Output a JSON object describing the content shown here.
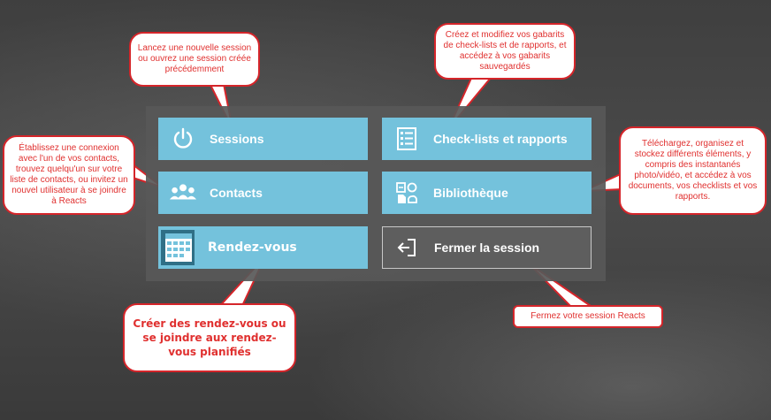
{
  "tiles": {
    "sessions": "Sessions",
    "checklists": "Check-lists et rapports",
    "contacts": "Contacts",
    "bibliotheque": "Bibliothèque",
    "rendezvous": "Rendez-vous",
    "logout": "Fermer la session"
  },
  "callouts": {
    "sessions": "Lancez une nouvelle session ou ouvrez une session créée précédemment",
    "checklists": "Créez et modifiez vos gabarits de check-lists et de rapports, et accédez à vos gabarits sauvegardés",
    "contacts": "Établissez une connexion avec l'un de vos contacts, trouvez quelqu'un sur votre liste de contacts, ou invitez un nouvel utilisateur à se joindre à Reacts",
    "bibliotheque": "Téléchargez, organisez et stockez différents éléments, y compris des instantanés photo/vidéo, et accédez à vos documents, vos checklists et vos rapports.",
    "rendezvous": "Créer des rendez-vous ou se joindre aux rendez-vous planifiés",
    "logout": "Fermez votre session Reacts"
  },
  "colors": {
    "tile": "#74c2dc",
    "logout_tile": "#5e5e5e",
    "panel": "#585858",
    "callout_border": "#d5252a",
    "callout_text": "#e0302f"
  },
  "icons": {
    "sessions": "power-icon",
    "checklists": "checklist-icon",
    "contacts": "people-icon",
    "bibliotheque": "library-icon",
    "rendezvous": "calendar-icon",
    "logout": "logout-icon"
  }
}
